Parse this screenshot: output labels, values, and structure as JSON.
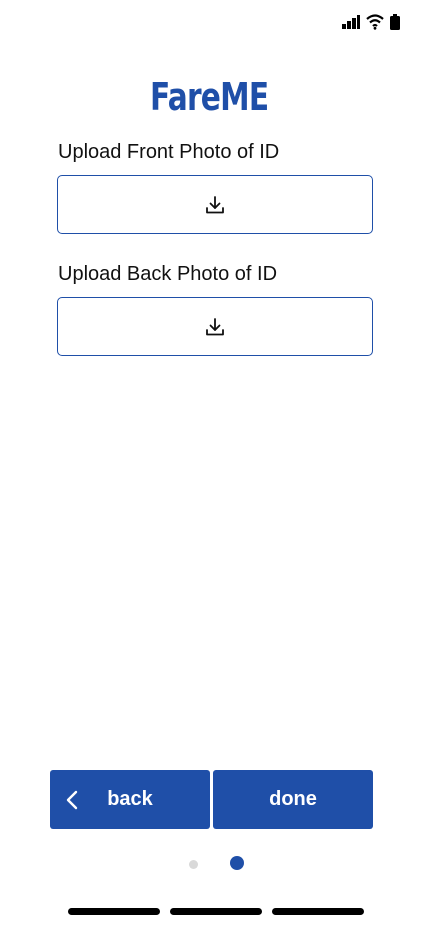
{
  "app": {
    "name": "FareME",
    "brand_color": "#1f4fa8"
  },
  "status_bar": {
    "icons": [
      "cellular-signal-icon",
      "wifi-icon",
      "battery-icon"
    ]
  },
  "uploads": [
    {
      "label": "Upload Front Photo of ID",
      "icon": "download-icon"
    },
    {
      "label": "Upload Back Photo of ID",
      "icon": "download-icon"
    }
  ],
  "footer": {
    "back_label": "back",
    "done_label": "done",
    "pager": {
      "total": 2,
      "current": 2
    }
  }
}
